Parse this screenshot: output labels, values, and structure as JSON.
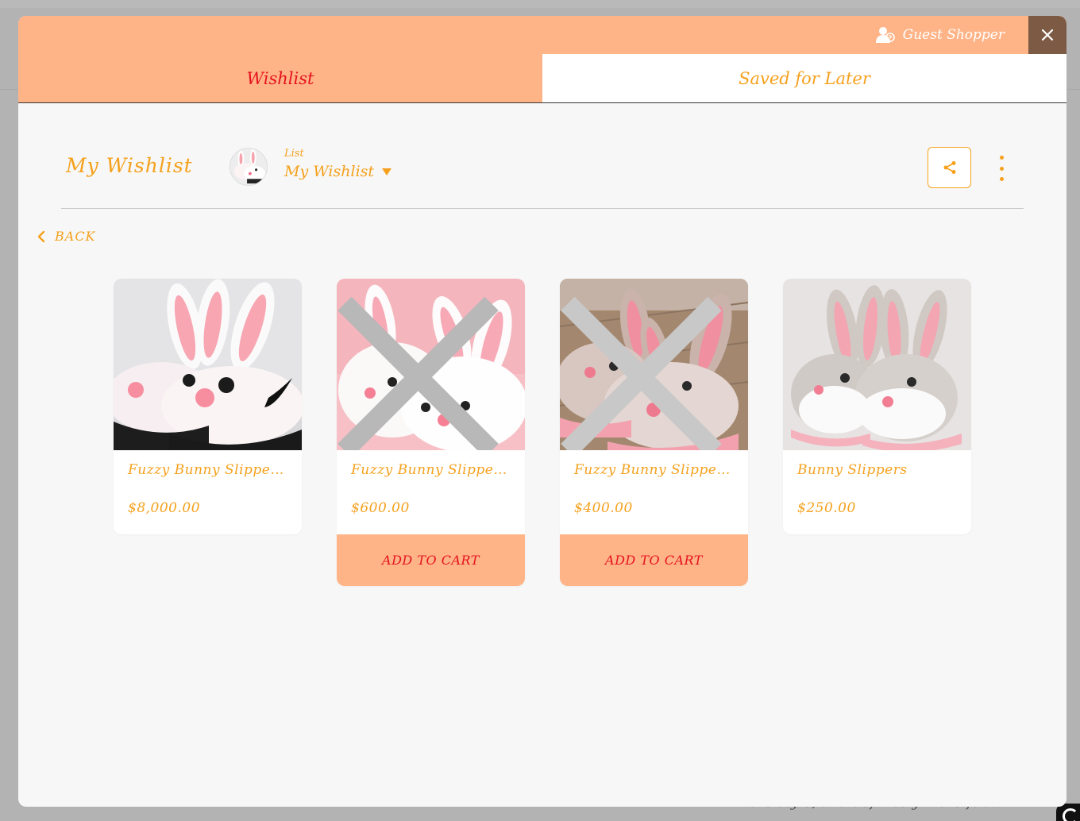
{
  "background": {
    "footer_text": "More style, and definitely more fuzz!"
  },
  "header": {
    "user_label": "Guest Shopper"
  },
  "tabs": [
    {
      "label": "Wishlist",
      "active": true
    },
    {
      "label": "Saved for Later",
      "active": false
    }
  ],
  "wishlist_header": {
    "title": "My Wishlist",
    "list_label": "List",
    "list_value": "My Wishlist"
  },
  "back_label": "BACK",
  "products": [
    {
      "name": "Fuzzy Bunny Slipper...",
      "price": "$8,000.00",
      "button": ""
    },
    {
      "name": "Fuzzy Bunny Slipper...",
      "price": "$600.00",
      "button": "ADD TO CART"
    },
    {
      "name": "Fuzzy Bunny Slipper...",
      "price": "$400.00",
      "button": "ADD TO CART"
    },
    {
      "name": "Bunny Slippers",
      "price": "$250.00",
      "button": ""
    }
  ],
  "colors": {
    "accent_peach": "#ffb487",
    "accent_orange": "#f5a11d",
    "accent_red": "#e5121e",
    "close_brown": "#7c5a44"
  },
  "icons": {
    "user": "guest-user-icon",
    "close": "close-icon",
    "share": "share-icon",
    "more": "more-vertical-icon",
    "back": "chevron-left-icon",
    "caret": "caret-down-icon",
    "remove": "remove-x-icon"
  }
}
